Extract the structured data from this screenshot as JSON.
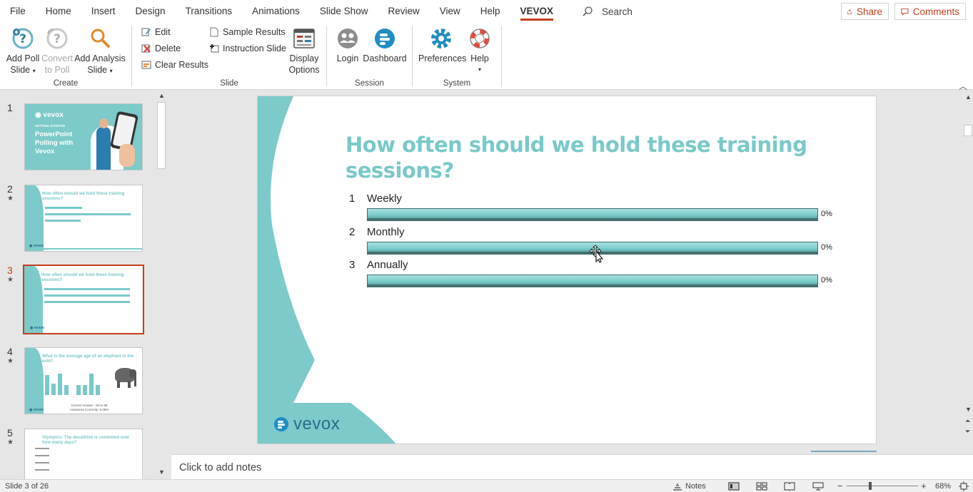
{
  "menu": {
    "tabs": [
      "File",
      "Home",
      "Insert",
      "Design",
      "Transitions",
      "Animations",
      "Slide Show",
      "Review",
      "View",
      "Help",
      "VEVOX"
    ],
    "active_tab": "VEVOX",
    "search_label": "Search",
    "share_label": "Share",
    "comments_label": "Comments"
  },
  "ribbon": {
    "create": {
      "label": "Create",
      "add_poll": "Add Poll",
      "add_poll_2": "Slide",
      "convert": "Convert",
      "convert_2": "to Poll",
      "add_analysis": "Add Analysis",
      "add_analysis_2": "Slide"
    },
    "slide": {
      "label": "Slide",
      "edit": "Edit",
      "delete": "Delete",
      "clear_results": "Clear Results",
      "sample_results": "Sample Results",
      "instruction_slide": "Instruction Slide",
      "display": "Display",
      "display_2": "Options"
    },
    "session": {
      "label": "Session",
      "login": "Login",
      "dashboard": "Dashboard"
    },
    "system": {
      "label": "System",
      "preferences": "Preferences",
      "help": "Help"
    }
  },
  "thumbnails": [
    {
      "num": "1",
      "star": false,
      "title": "PowerPoint Polling with Vevox",
      "kicker": "GETTING STARTED"
    },
    {
      "num": "2",
      "star": true,
      "title": "How often should we hold these training sessions?"
    },
    {
      "num": "3",
      "star": true,
      "title": "How often should we hold these training sessions?",
      "active": true
    },
    {
      "num": "4",
      "star": true,
      "title": "What is the average age of an elephant in the wild?",
      "caption1": "Correct Answer : 50 to 59",
      "caption2": "Answered Correctly: 9.09%"
    },
    {
      "num": "5",
      "star": true,
      "title": "Olympics: The decathlon is contested over how many days?"
    }
  ],
  "slide": {
    "title": "How often should we hold these training sessions?",
    "options": [
      {
        "num": "1",
        "label": "Weekly",
        "pct": "0%",
        "value": 1.0
      },
      {
        "num": "2",
        "label": "Monthly",
        "pct": "0%",
        "value": 1.0
      },
      {
        "num": "3",
        "label": "Annually",
        "pct": "0%",
        "value": 1.0
      }
    ],
    "logo_text": "vevox"
  },
  "notes": {
    "placeholder": "Click to add notes"
  },
  "status": {
    "slide_info": "Slide 3 of 26",
    "notes_label": "Notes",
    "zoom": "68%"
  },
  "colors": {
    "accent": "#c43e1c",
    "teal": "#79c9c9",
    "vevox_blue": "#2a6b8a"
  }
}
